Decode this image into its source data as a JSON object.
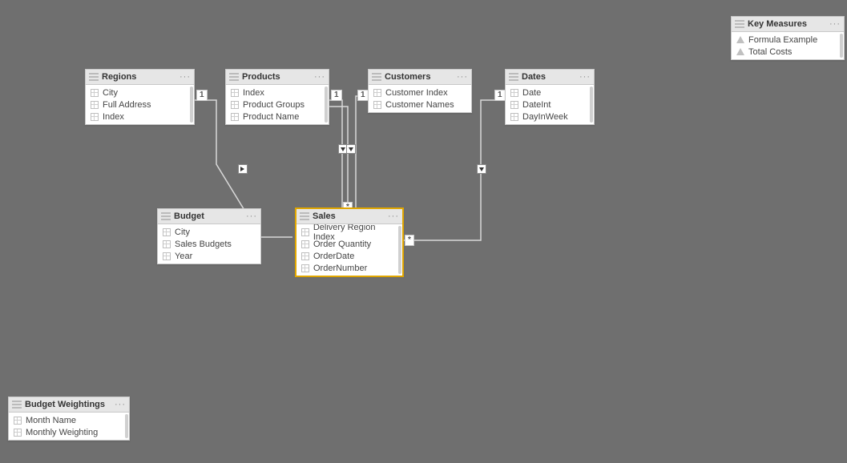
{
  "tables": {
    "regions": {
      "title": "Regions",
      "fields": [
        "City",
        "Full Address",
        "Index"
      ]
    },
    "products": {
      "title": "Products",
      "fields": [
        "Index",
        "Product Groups",
        "Product Name"
      ]
    },
    "customers": {
      "title": "Customers",
      "fields": [
        "Customer Index",
        "Customer Names"
      ]
    },
    "dates": {
      "title": "Dates",
      "fields": [
        "Date",
        "DateInt",
        "DayInWeek"
      ]
    },
    "budget": {
      "title": "Budget",
      "fields": [
        "City",
        "Sales Budgets",
        "Year"
      ]
    },
    "sales": {
      "title": "Sales",
      "fields": [
        "Delivery Region Index",
        "Order Quantity",
        "OrderDate",
        "OrderNumber"
      ]
    },
    "key_measures": {
      "title": "Key Measures",
      "fields": [
        "Formula Example",
        "Total Costs"
      ]
    },
    "budget_weightings": {
      "title": "Budget Weightings",
      "fields": [
        "Month Name",
        "Monthly Weighting"
      ]
    }
  },
  "cardinality": {
    "one": "1",
    "many": "*"
  },
  "more": "···"
}
